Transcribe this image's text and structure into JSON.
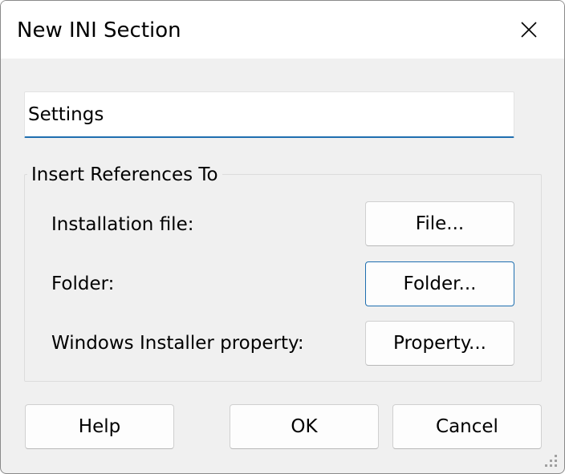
{
  "window": {
    "title": "New INI Section",
    "close_icon": "close-icon"
  },
  "section_name": {
    "value": "Settings"
  },
  "references": {
    "group_label": "Insert References To",
    "rows": [
      {
        "label": "Installation file:",
        "button": "File..."
      },
      {
        "label": "Folder:",
        "button": "Folder..."
      },
      {
        "label": "Windows Installer property:",
        "button": "Property..."
      }
    ]
  },
  "footer": {
    "help": "Help",
    "ok": "OK",
    "cancel": "Cancel"
  },
  "colors": {
    "accent": "#1f6fb0",
    "dialog_bg": "#f0f0f0",
    "title_bg": "#ffffff"
  }
}
